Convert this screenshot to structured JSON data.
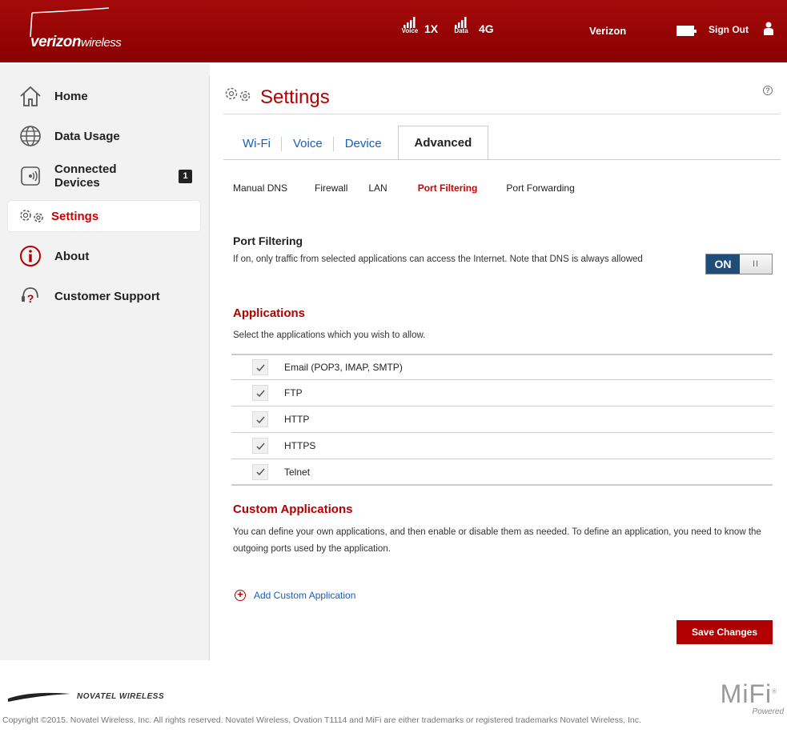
{
  "header": {
    "brand_bold": "verizon",
    "brand_light": "wireless",
    "voice_label": "Voice",
    "tech_1x": "1X",
    "data_label": "Data",
    "tech_4g": "4G",
    "carrier": "Verizon",
    "sign_out": "Sign Out"
  },
  "sidebar": {
    "items": [
      {
        "label": "Home",
        "icon": "home-icon"
      },
      {
        "label": "Data Usage",
        "icon": "globe-icon"
      },
      {
        "label": "Connected Devices",
        "label_line1": "Connected",
        "label_line2": "Devices",
        "icon": "connected-devices-icon",
        "badge": "1"
      },
      {
        "label": "Settings",
        "icon": "gears-icon",
        "active": true
      },
      {
        "label": "About",
        "icon": "info-icon"
      },
      {
        "label": "Customer Support",
        "icon": "headset-icon"
      }
    ]
  },
  "main": {
    "title": "Settings",
    "help": "?",
    "tabs": [
      {
        "label": "Wi-Fi"
      },
      {
        "label": "Voice"
      },
      {
        "label": "Device"
      },
      {
        "label": "Advanced",
        "active": true
      }
    ],
    "subtabs": [
      {
        "label": "Manual DNS"
      },
      {
        "label": "Firewall"
      },
      {
        "label": "LAN"
      },
      {
        "label": "Port Filtering",
        "active": true
      },
      {
        "label": "Port Forwarding"
      }
    ],
    "port_filtering": {
      "heading": "Port Filtering",
      "description": "If on, only traffic from selected applications can access the Internet. Note that DNS is always allowed",
      "toggle_on": "ON",
      "toggle_knob": "II",
      "toggle_state": true
    },
    "applications": {
      "heading": "Applications",
      "description": "Select the applications which you wish to allow.",
      "items": [
        {
          "label": "Email (POP3, IMAP, SMTP)",
          "checked": true
        },
        {
          "label": "FTP",
          "checked": true
        },
        {
          "label": "HTTP",
          "checked": true
        },
        {
          "label": "HTTPS",
          "checked": true
        },
        {
          "label": "Telnet",
          "checked": true
        }
      ]
    },
    "custom_applications": {
      "heading": "Custom Applications",
      "description": "You can define your own applications, and then enable or disable them as needed. To define an application, you need to know the outgoing ports used by the application.",
      "add_label": "Add Custom Application"
    },
    "save_label": "Save Changes"
  },
  "footer": {
    "novatel": "NOVATEL WIRELESS",
    "mifi": "MiFi",
    "mifi_reg": "®",
    "mifi_powered": "Powered",
    "copyright": "Copyright ©2015. Novatel Wireless, Inc. All rights reserved. Novatel Wireless, Ovation T1114 and MiFi are either trademarks or registered trademarks Novatel Wireless, Inc."
  },
  "colors": {
    "brand_red": "#b20000",
    "header_red": "#9a0505",
    "link_blue": "#1a5fb4",
    "toggle_blue": "#1e4d7a"
  }
}
